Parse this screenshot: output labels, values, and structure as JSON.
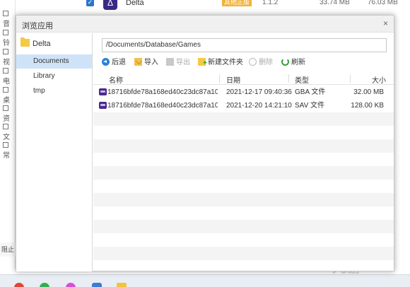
{
  "background": {
    "app_row": {
      "name": "Delta",
      "badge": "其他正版",
      "version": "1.1.2",
      "size1": "33.74 MB",
      "size2": "76.03 MB"
    },
    "left_nav": [
      "音",
      "铃",
      "视",
      "电",
      "桌",
      "资",
      "文",
      "常"
    ],
    "bottom_left_text": "阻止",
    "watermark": "九游"
  },
  "dialog": {
    "title": "浏览应用",
    "close_glyph": "×",
    "sidebar": {
      "root": "Delta",
      "items": [
        {
          "label": "Documents",
          "active": true
        },
        {
          "label": "Library",
          "active": false
        },
        {
          "label": "tmp",
          "active": false
        }
      ]
    },
    "path": "/Documents/Database/Games",
    "toolbar": {
      "back": "后退",
      "import": "导入",
      "export": "导出",
      "new_folder": "新建文件夹",
      "delete": "删除",
      "refresh": "刷新"
    },
    "columns": {
      "name": "名称",
      "date": "日期",
      "type": "类型",
      "size": "大小"
    },
    "files": [
      {
        "name": "18716bfde78a168ed40c23dc87a10...",
        "date": "2021-12-17 09:40:36",
        "type": "GBA 文件",
        "size": "32.00 MB"
      },
      {
        "name": "18716bfde78a168ed40c23dc87a10...",
        "date": "2021-12-20 14:21:10",
        "type": "SAV 文件",
        "size": "128.00 KB"
      }
    ]
  }
}
